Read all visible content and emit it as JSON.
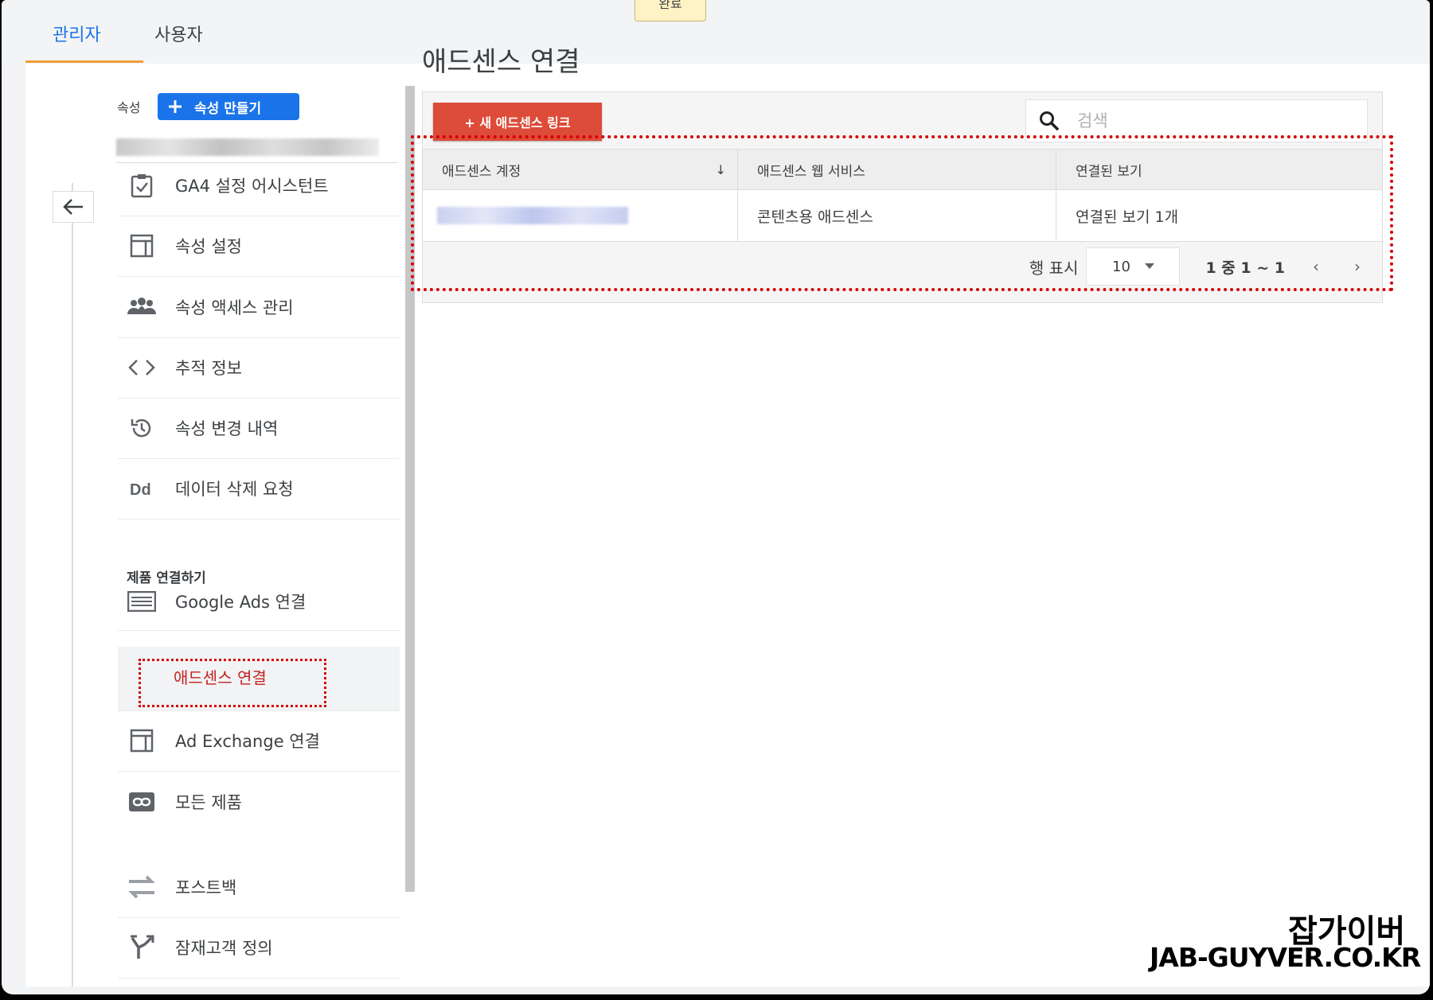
{
  "tabs": [
    {
      "label": "관리자",
      "active": true
    },
    {
      "label": "사용자",
      "active": false
    }
  ],
  "notice_text": "완료",
  "sidebar": {
    "property_label": "속성",
    "create_button": "속성 만들기",
    "items": [
      {
        "label": "GA4 설정 어시스턴트",
        "icon": "clipboard-check-icon"
      },
      {
        "label": "속성 설정",
        "icon": "window-layout-icon"
      },
      {
        "label": "속성 액세스 관리",
        "icon": "people-group-icon"
      },
      {
        "label": "추적 정보",
        "icon": "code-brackets-icon"
      },
      {
        "label": "속성 변경 내역",
        "icon": "history-icon"
      },
      {
        "label": "데이터 삭제 요청",
        "icon": "dd-icon"
      }
    ],
    "section_header": "제품 연결하기",
    "product_items": [
      {
        "label": "Google Ads 연결",
        "icon": "ads-list-icon"
      },
      {
        "label": "애드센스 연결",
        "icon": "",
        "selected": true
      },
      {
        "label": "Ad Exchange 연결",
        "icon": "window-layout-icon"
      },
      {
        "label": "모든 제품",
        "icon": "link-icon"
      }
    ],
    "bottom_items": [
      {
        "label": "포스트백",
        "icon": "arrows-swap-icon"
      },
      {
        "label": "잠재고객 정의",
        "icon": "fork-icon"
      }
    ]
  },
  "main": {
    "title": "애드센스 연결",
    "new_link_button": "+ 새 애드센스 링크",
    "search_placeholder": "검색",
    "columns": [
      "애드센스 계정",
      "애드센스 웹 서비스",
      "연결된 보기"
    ],
    "rows": [
      {
        "service": "콘텐츠용 애드센스",
        "views": "연결된 보기 1개"
      }
    ],
    "rows_label": "행 표시",
    "rows_value": "10",
    "range": "1 중 1 ~ 1"
  },
  "watermark": {
    "line1": "잡가이버",
    "line2": "JAB-GUYVER.CO.KR"
  },
  "colors": {
    "accent_blue": "#1a73e8",
    "new_button_red": "#dd4b39",
    "highlight_red": "#d50000",
    "tab_underline": "#f29d38"
  }
}
